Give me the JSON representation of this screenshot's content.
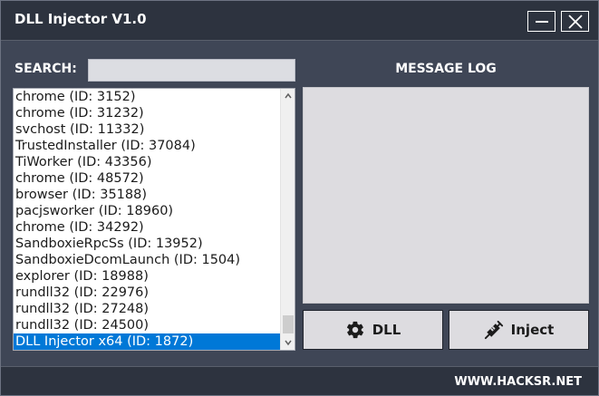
{
  "window": {
    "title": "DLL Injector V1.0",
    "minimize_icon": "minimize-icon",
    "close_icon": "close-icon"
  },
  "search": {
    "label": "SEARCH:",
    "value": "",
    "placeholder": ""
  },
  "process_list": {
    "items": [
      "chrome (ID: 3152)",
      "chrome (ID: 31232)",
      "svchost (ID: 11332)",
      "TrustedInstaller (ID: 37084)",
      "TiWorker (ID: 43356)",
      "chrome (ID: 48572)",
      "browser (ID: 35188)",
      "pacjsworker (ID: 18960)",
      "chrome (ID: 34292)",
      "SandboxieRpcSs (ID: 13952)",
      "SandboxieDcomLaunch (ID: 1504)",
      "explorer (ID: 18988)",
      "rundll32 (ID: 22976)",
      "rundll32 (ID: 27248)",
      "rundll32 (ID: 24500)",
      "DLL Injector x64 (ID: 1872)"
    ],
    "selected_index": 15
  },
  "message_log": {
    "label": "MESSAGE LOG",
    "content": ""
  },
  "buttons": {
    "dll_label": "DLL",
    "dll_icon": "gear-icon",
    "inject_label": "Inject",
    "inject_icon": "syringe-icon"
  },
  "footer": {
    "text": "WWW.HACKSR.NET"
  },
  "colors": {
    "window_bg": "#3f4656",
    "titlebar_bg": "#2d333f",
    "panel_bg": "#dddce0",
    "selection": "#0078d7"
  }
}
